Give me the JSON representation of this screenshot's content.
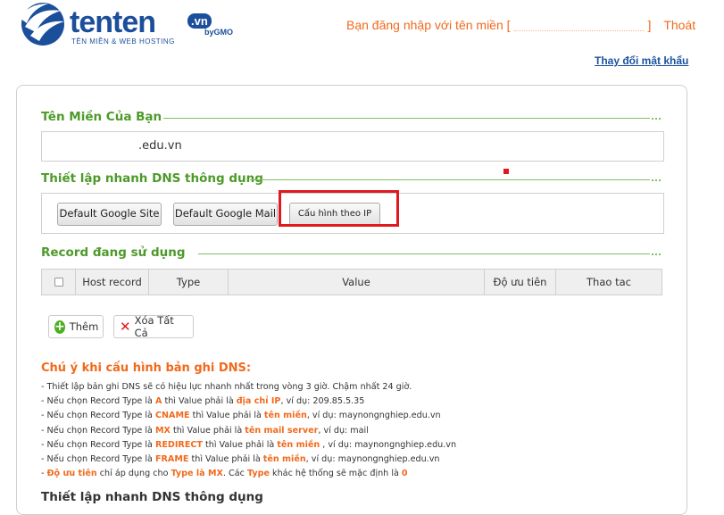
{
  "header": {
    "logo_word": "tenten",
    "logo_vn": ".vn",
    "logo_gmo": "byGMO",
    "logo_tagline": "TÊN MIỀN & WEB HOSTING",
    "login_prefix": "Bạn đăng nhập với tên miền [",
    "login_suffix": "]",
    "logout_label": "Thoát",
    "change_password_label": "Thay đổi mật khẩu"
  },
  "domain_section": {
    "title": "Tên Miền Của Bạn",
    "domain_value": ".edu.vn"
  },
  "quick_dns": {
    "title": "Thiết lập nhanh DNS thông dụng",
    "buttons": [
      "Default Google Site",
      "Default Google Mail",
      "Cấu hình theo IP"
    ]
  },
  "records": {
    "title": "Record đang sử dụng",
    "columns": [
      "Host record",
      "Type",
      "Value",
      "Độ ưu tiên",
      "Thao tac"
    ],
    "add_label": "Thêm",
    "delete_all_label": "Xóa Tất Cả"
  },
  "notes": {
    "title": "Chú ý khi cấu hình bản ghi DNS:",
    "line1": "- Thiết lập bản ghi DNS sẽ có hiệu lực nhanh nhất trong vòng 3 giờ. Chậm nhất 24 giờ.",
    "line2_a": "- Nếu chọn Record Type là ",
    "line2_type": "A",
    "line2_b": " thì Value phải là ",
    "line2_val": "địa chỉ IP",
    "line2_c": ", ví dụ: 209.85.5.35",
    "line3_a": "- Nếu chọn Record Type là ",
    "line3_type": "CNAME",
    "line3_b": " thì Value phải là ",
    "line3_val": "tên miền",
    "line3_c": ", ví dụ: maynongnghiep.edu.vn",
    "line4_a": "- Nếu chọn Record Type là ",
    "line4_type": "MX",
    "line4_b": " thì Value phải là ",
    "line4_val": "tên mail server",
    "line4_c": ", ví dụ: mail",
    "line5_a": "- Nếu chọn Record Type là ",
    "line5_type": "REDIRECT",
    "line5_b": " thì Value phải là ",
    "line5_val": "tên miền",
    "line5_c": " , ví dụ: maynongnghiep.edu.vn",
    "line6_a": "- Nếu chọn Record Type là ",
    "line6_type": "FRAME",
    "line6_b": " thì Value phải là ",
    "line6_val": "tên miền",
    "line6_c": ", ví dụ: maynongnghiep.edu.vn",
    "line7_a": "- ",
    "line7_pri": "Độ ưu tiên",
    "line7_b": " chỉ áp dụng cho ",
    "line7_types": "Type là MX",
    "line7_c": ". Các ",
    "line7_type": "Type",
    "line7_d": " khác hệ thống sẽ mặc định là ",
    "line7_zero": "0"
  },
  "next_section_title": "Thiết lập nhanh DNS thông dụng",
  "colors": {
    "accent_green": "#4d9a2a",
    "accent_orange": "#f06a1c",
    "brand_blue": "#1b4f9c",
    "highlight_red": "#e0191f"
  }
}
